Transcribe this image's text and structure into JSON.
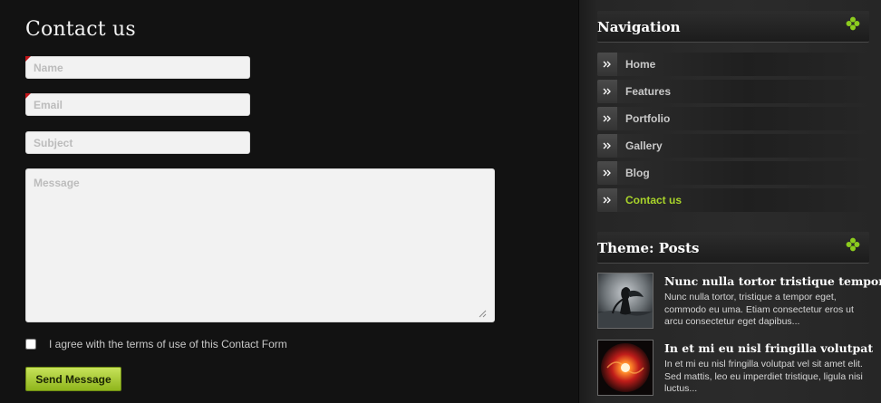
{
  "page": {
    "title": "Contact us"
  },
  "form": {
    "name_placeholder": "Name",
    "email_placeholder": "Email",
    "subject_placeholder": "Subject",
    "message_placeholder": "Message",
    "agree_label": "I agree with the terms of use of this Contact Form",
    "agree_checked": false,
    "submit_label": "Send Message"
  },
  "sidebar": {
    "navigation": {
      "title": "Navigation",
      "icon": "clover-icon",
      "items": [
        {
          "label": "Home",
          "active": false
        },
        {
          "label": "Features",
          "active": false
        },
        {
          "label": "Portfolio",
          "active": false
        },
        {
          "label": "Gallery",
          "active": false
        },
        {
          "label": "Blog",
          "active": false
        },
        {
          "label": "Contact us",
          "active": true
        }
      ]
    },
    "posts": {
      "title": "Theme: Posts",
      "icon": "clover-icon",
      "items": [
        {
          "title": "Nunc nulla tortor tristique tempor",
          "excerpt": "Nunc nulla tortor, tristique a tempor eget, commodo eu uma. Etiam consectetur eros ut arcu consectetur eget dapibus...",
          "thumb": "storm-figure-thumbnail"
        },
        {
          "title": "In et mi eu nisl fringilla volutpat",
          "excerpt": "In et mi eu nisl fringilla volutpat vel sit amet elit. Sed mattis, leo eu imperdiet tristique, ligula nisi luctus...",
          "thumb": "fiery-orb-thumbnail"
        }
      ]
    }
  },
  "colors": {
    "background": "#121212",
    "accent": "#a9d42a",
    "button": "#a8c83a",
    "required": "#c0161a"
  }
}
